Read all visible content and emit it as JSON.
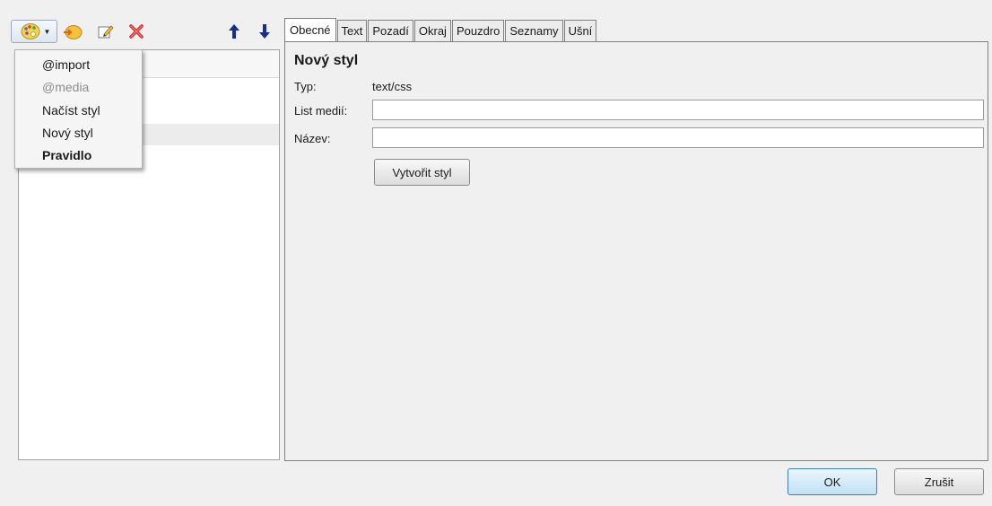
{
  "toolbar": {
    "icons": [
      "new-style-icon",
      "import-icon",
      "edit-icon",
      "delete-icon",
      "move-up-icon",
      "move-down-icon"
    ]
  },
  "dropdown": {
    "items": [
      {
        "label": "@import",
        "enabled": true
      },
      {
        "label": "@media",
        "enabled": false
      },
      {
        "label": "Načíst styl",
        "enabled": true
      },
      {
        "label": "Nový styl",
        "enabled": true
      },
      {
        "label": "Pravidlo",
        "enabled": true,
        "bold": true
      }
    ]
  },
  "tabs": [
    {
      "label": "Obecné",
      "active": true
    },
    {
      "label": "Text"
    },
    {
      "label": "Pozadí"
    },
    {
      "label": "Okraj"
    },
    {
      "label": "Pouzdro"
    },
    {
      "label": "Seznamy"
    },
    {
      "label": "Ušní"
    }
  ],
  "form": {
    "title": "Nový styl",
    "type_label": "Typ:",
    "type_value": "text/css",
    "media_label": "List medií:",
    "media_value": "",
    "name_label": "Název:",
    "name_value": "",
    "create_button": "Vytvořit styl"
  },
  "footer": {
    "ok": "OK",
    "cancel": "Zrušit"
  },
  "colors": {
    "up_down_arrows": "#1a2d8c",
    "delete_icon": "#d03030",
    "ok_button_border": "#3c7fb1"
  }
}
